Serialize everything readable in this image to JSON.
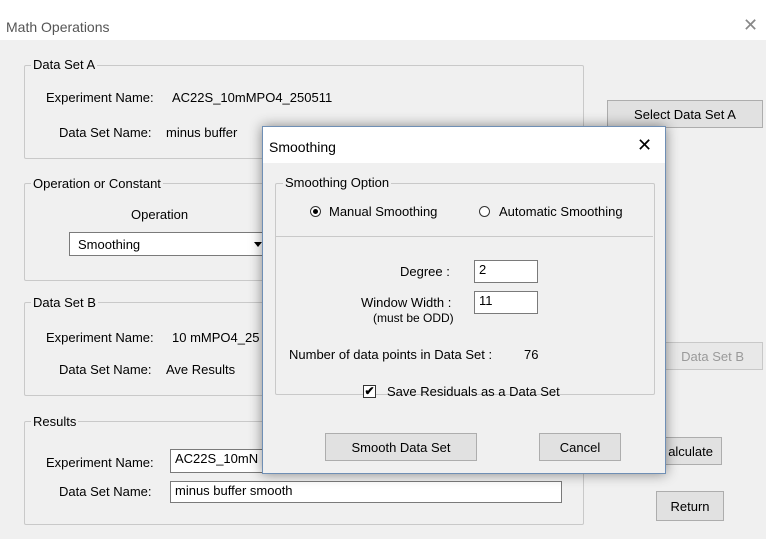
{
  "window": {
    "title": "Math Operations",
    "close_glyph": "✕"
  },
  "data_set_a": {
    "legend": "Data Set A",
    "experiment_label": "Experiment Name:",
    "experiment_value": "AC22S_10mMPO4_250511",
    "dataset_label": "Data Set Name:",
    "dataset_value": "minus buffer",
    "select_button": "Select Data Set A"
  },
  "operation": {
    "legend": "Operation or Constant",
    "operation_label": "Operation",
    "selected": "Smoothing"
  },
  "data_set_b": {
    "legend": "Data Set B",
    "experiment_label": "Experiment Name:",
    "experiment_value": "10 mMPO4_25",
    "dataset_label": "Data Set Name:",
    "dataset_value": "Ave Results",
    "select_button": "Data Set B"
  },
  "results": {
    "legend": "Results",
    "experiment_label": "Experiment Name:",
    "experiment_value": "AC22S_10mN",
    "dataset_label": "Data Set Name:",
    "dataset_value": "minus buffer smooth",
    "calculate_button": "alculate",
    "return_button": "Return"
  },
  "smoothing_dialog": {
    "title": "Smoothing",
    "close_glyph": "✕",
    "option_legend": "Smoothing Option",
    "manual_label": "Manual Smoothing",
    "automatic_label": "Automatic Smoothing",
    "degree_label": "Degree :",
    "degree_value": "2",
    "window_label": "Window Width :",
    "window_note": "(must be ODD)",
    "window_value": "11",
    "points_label": "Number of data points in Data Set :",
    "points_value": "76",
    "residuals_label": "Save Residuals as a Data Set",
    "check_glyph": "✔",
    "smooth_button": "Smooth Data Set",
    "cancel_button": "Cancel"
  }
}
